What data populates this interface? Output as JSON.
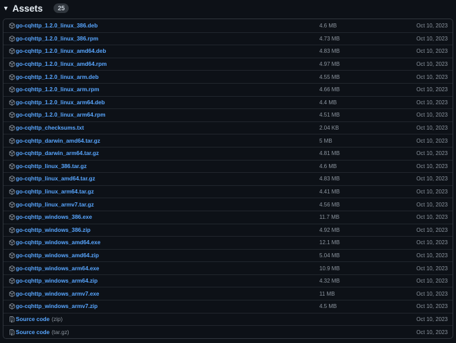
{
  "section": {
    "title": "Assets",
    "count": "25"
  },
  "assets": [
    {
      "name": "go-cqhttp_1.2.0_linux_386.deb",
      "size": "4.6 MB",
      "date": "Oct 10, 2023",
      "icon": "package-icon"
    },
    {
      "name": "go-cqhttp_1.2.0_linux_386.rpm",
      "size": "4.73 MB",
      "date": "Oct 10, 2023",
      "icon": "package-icon"
    },
    {
      "name": "go-cqhttp_1.2.0_linux_amd64.deb",
      "size": "4.83 MB",
      "date": "Oct 10, 2023",
      "icon": "package-icon"
    },
    {
      "name": "go-cqhttp_1.2.0_linux_amd64.rpm",
      "size": "4.97 MB",
      "date": "Oct 10, 2023",
      "icon": "package-icon"
    },
    {
      "name": "go-cqhttp_1.2.0_linux_arm.deb",
      "size": "4.55 MB",
      "date": "Oct 10, 2023",
      "icon": "package-icon"
    },
    {
      "name": "go-cqhttp_1.2.0_linux_arm.rpm",
      "size": "4.66 MB",
      "date": "Oct 10, 2023",
      "icon": "package-icon"
    },
    {
      "name": "go-cqhttp_1.2.0_linux_arm64.deb",
      "size": "4.4 MB",
      "date": "Oct 10, 2023",
      "icon": "package-icon"
    },
    {
      "name": "go-cqhttp_1.2.0_linux_arm64.rpm",
      "size": "4.51 MB",
      "date": "Oct 10, 2023",
      "icon": "package-icon"
    },
    {
      "name": "go-cqhttp_checksums.txt",
      "size": "2.04 KB",
      "date": "Oct 10, 2023",
      "icon": "package-icon"
    },
    {
      "name": "go-cqhttp_darwin_amd64.tar.gz",
      "size": "5 MB",
      "date": "Oct 10, 2023",
      "icon": "package-icon"
    },
    {
      "name": "go-cqhttp_darwin_arm64.tar.gz",
      "size": "4.81 MB",
      "date": "Oct 10, 2023",
      "icon": "package-icon"
    },
    {
      "name": "go-cqhttp_linux_386.tar.gz",
      "size": "4.6 MB",
      "date": "Oct 10, 2023",
      "icon": "package-icon"
    },
    {
      "name": "go-cqhttp_linux_amd64.tar.gz",
      "size": "4.83 MB",
      "date": "Oct 10, 2023",
      "icon": "package-icon"
    },
    {
      "name": "go-cqhttp_linux_arm64.tar.gz",
      "size": "4.41 MB",
      "date": "Oct 10, 2023",
      "icon": "package-icon"
    },
    {
      "name": "go-cqhttp_linux_armv7.tar.gz",
      "size": "4.56 MB",
      "date": "Oct 10, 2023",
      "icon": "package-icon"
    },
    {
      "name": "go-cqhttp_windows_386.exe",
      "size": "11.7 MB",
      "date": "Oct 10, 2023",
      "icon": "package-icon"
    },
    {
      "name": "go-cqhttp_windows_386.zip",
      "size": "4.92 MB",
      "date": "Oct 10, 2023",
      "icon": "package-icon"
    },
    {
      "name": "go-cqhttp_windows_amd64.exe",
      "size": "12.1 MB",
      "date": "Oct 10, 2023",
      "icon": "package-icon"
    },
    {
      "name": "go-cqhttp_windows_amd64.zip",
      "size": "5.04 MB",
      "date": "Oct 10, 2023",
      "icon": "package-icon"
    },
    {
      "name": "go-cqhttp_windows_arm64.exe",
      "size": "10.9 MB",
      "date": "Oct 10, 2023",
      "icon": "package-icon"
    },
    {
      "name": "go-cqhttp_windows_arm64.zip",
      "size": "4.32 MB",
      "date": "Oct 10, 2023",
      "icon": "package-icon"
    },
    {
      "name": "go-cqhttp_windows_armv7.exe",
      "size": "11 MB",
      "date": "Oct 10, 2023",
      "icon": "package-icon"
    },
    {
      "name": "go-cqhttp_windows_armv7.zip",
      "size": "4.5 MB",
      "date": "Oct 10, 2023",
      "icon": "package-icon"
    },
    {
      "name": "Source code",
      "suffix": "(zip)",
      "size": "",
      "date": "Oct 10, 2023",
      "icon": "file-zip-icon"
    },
    {
      "name": "Source code",
      "suffix": "(tar.gz)",
      "size": "",
      "date": "Oct 10, 2023",
      "icon": "file-zip-icon"
    }
  ],
  "colors": {
    "background": "#0d1117",
    "border": "#30363d",
    "link": "#58a6ff",
    "muted": "#8b949e"
  }
}
